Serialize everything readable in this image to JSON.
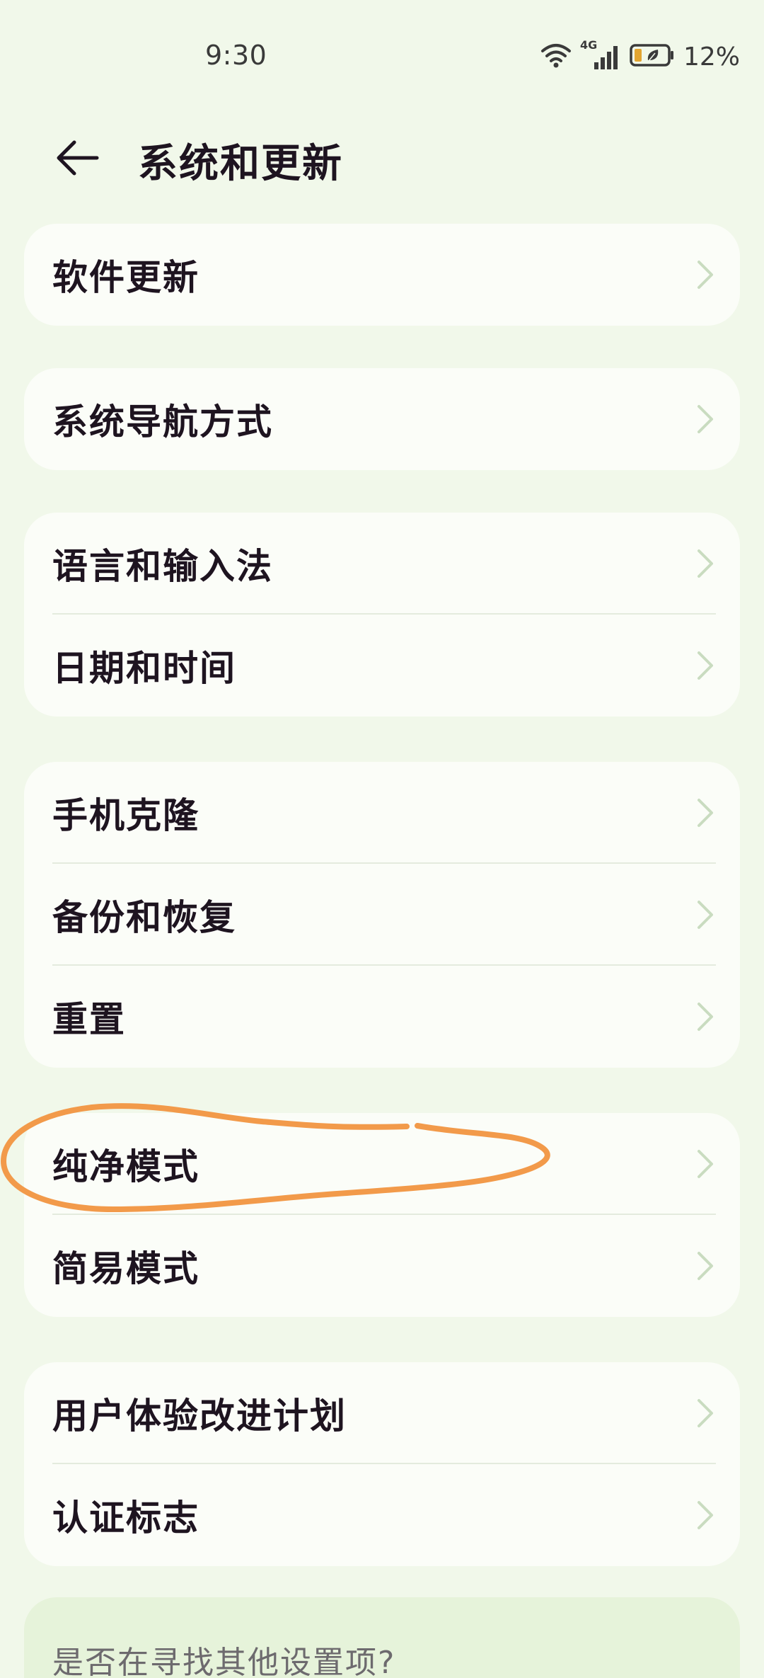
{
  "status_bar": {
    "time": "9:30",
    "network": "4G",
    "battery_percent": "12%",
    "icons": [
      "wifi-icon",
      "cellular-signal-icon",
      "battery-saver-icon"
    ]
  },
  "header": {
    "back_icon": "arrow-left-icon",
    "title": "系统和更新"
  },
  "groups": [
    {
      "items": [
        {
          "label": "软件更新"
        }
      ]
    },
    {
      "items": [
        {
          "label": "系统导航方式"
        }
      ]
    },
    {
      "items": [
        {
          "label": "语言和输入法"
        },
        {
          "label": "日期和时间"
        }
      ]
    },
    {
      "items": [
        {
          "label": "手机克隆"
        },
        {
          "label": "备份和恢复"
        },
        {
          "label": "重置"
        }
      ]
    },
    {
      "items": [
        {
          "label": "纯净模式"
        },
        {
          "label": "简易模式"
        }
      ]
    },
    {
      "items": [
        {
          "label": "用户体验改进计划"
        },
        {
          "label": "认证标志"
        }
      ]
    }
  ],
  "hint": {
    "text": "是否在寻找其他设置项?"
  },
  "colors": {
    "background": "#f1f8ea",
    "card": "#fbfdf8",
    "chevron": "#c9dcc0",
    "annotation": "#f29a4a",
    "battery_fill": "#e3a531"
  },
  "annotation": {
    "shape": "hand-drawn-ellipse",
    "highlights": "纯净模式"
  }
}
